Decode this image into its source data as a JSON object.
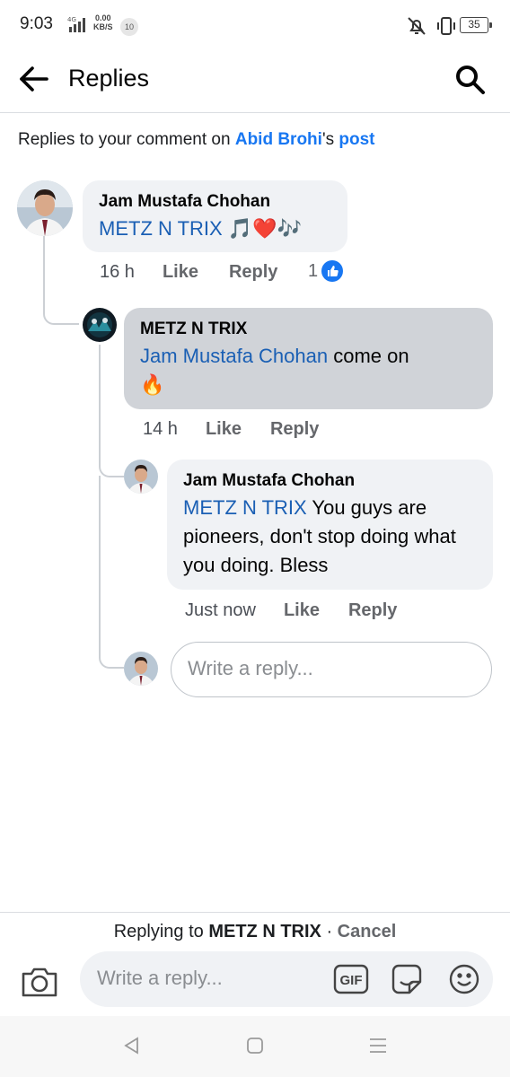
{
  "status_bar": {
    "time": "9:03",
    "network": "4G",
    "speed_value": "0.00",
    "speed_unit": "KB/S",
    "notification_count": "10",
    "battery": "35"
  },
  "header": {
    "title": "Replies"
  },
  "context": {
    "prefix": "Replies to your comment on ",
    "person": "Abid Brohi",
    "possessive": "'s ",
    "post_link": "post"
  },
  "comments": [
    {
      "author": "Jam Mustafa Chohan",
      "mention": "METZ N TRIX",
      "text": "",
      "emoji": "🎵❤️🎶",
      "time": "16 h",
      "like_label": "Like",
      "reply_label": "Reply",
      "reaction_count": "1"
    },
    {
      "author": "METZ N TRIX",
      "mention": "Jam Mustafa Chohan",
      "text": " come on",
      "emoji": "🔥",
      "time": "14 h",
      "like_label": "Like",
      "reply_label": "Reply"
    },
    {
      "author": "Jam Mustafa Chohan",
      "mention": "METZ N TRIX",
      "text": " You guys are pioneers, don't stop doing what you doing. Bless",
      "time": "Just now",
      "like_label": "Like",
      "reply_label": "Reply"
    }
  ],
  "inline_reply": {
    "placeholder": "Write a reply..."
  },
  "composer": {
    "replying_prefix": "Replying to ",
    "replying_to": "METZ N TRIX",
    "separator": " · ",
    "cancel_label": "Cancel",
    "placeholder": "Write a reply...",
    "gif_label": "GIF"
  },
  "colors": {
    "link_blue": "#1877f2",
    "mention_blue": "#1a5fb4",
    "bubble_gray": "#f0f2f5",
    "highlight_bubble": "#d0d3d8"
  }
}
